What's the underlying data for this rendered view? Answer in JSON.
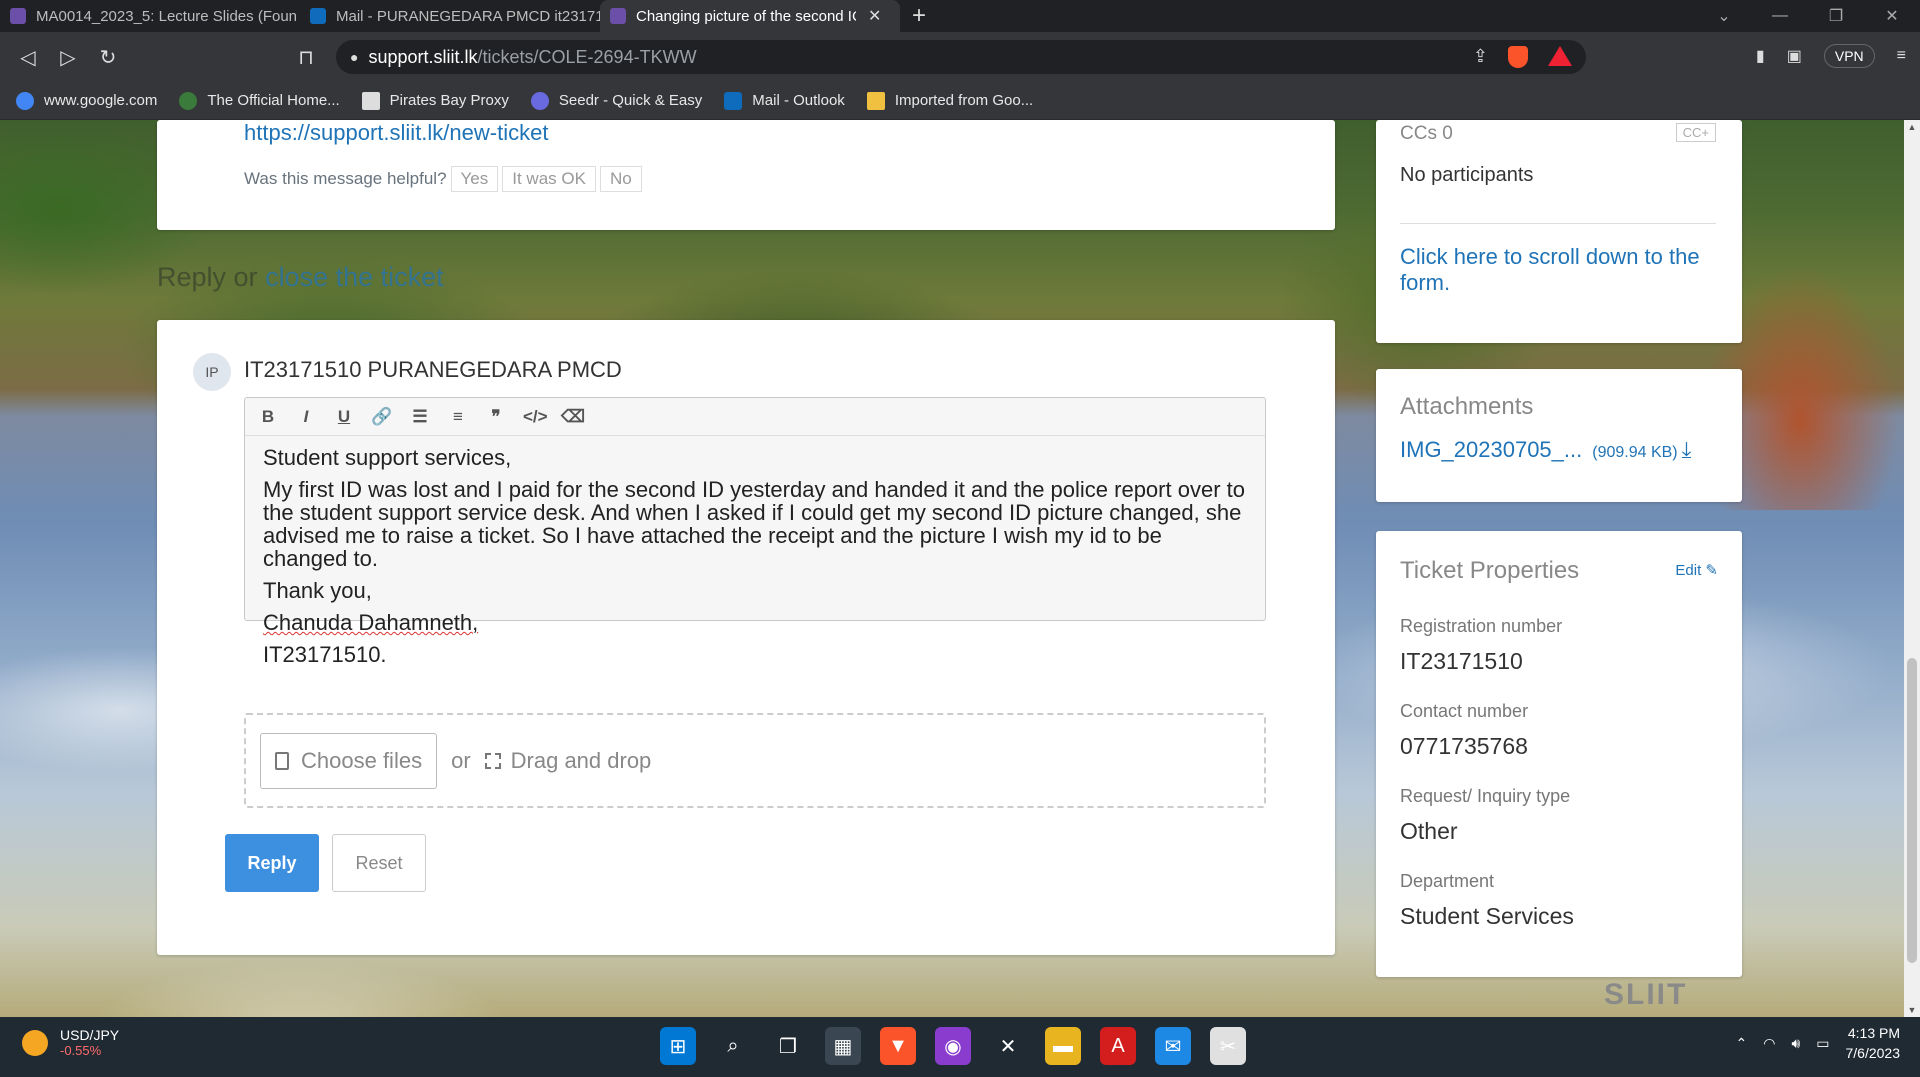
{
  "browser": {
    "tabs": [
      {
        "title": "MA0014_2023_5: Lecture Slides (Foun",
        "active": false,
        "favicon_color": "#6b4fa8"
      },
      {
        "title": "Mail - PURANEGEDARA PMCD it23171",
        "active": false,
        "favicon_color": "#0f6cbd"
      },
      {
        "title": "Changing picture of the second IC",
        "active": true,
        "favicon_color": "#6b4fa8"
      }
    ],
    "new_tab_label": "+",
    "url_host": "support.sliit.lk",
    "url_path": "/tickets/COLE-2694-TKWW",
    "vpn_label": "VPN",
    "bookmarks": [
      {
        "label": "www.google.com",
        "icon": "google-icon",
        "color": "#4285f4"
      },
      {
        "label": "The Official Home...",
        "icon": "leaf-icon",
        "color": "#3a7a3a"
      },
      {
        "label": "Pirates Bay Proxy",
        "icon": "monitor-icon",
        "color": "#dddddd"
      },
      {
        "label": "Seedr - Quick & Easy",
        "icon": "seed-icon",
        "color": "#6a6ae0"
      },
      {
        "label": "Mail - Outlook",
        "icon": "outlook-icon",
        "color": "#0f6cbd"
      },
      {
        "label": "Imported from Goo...",
        "icon": "folder-icon",
        "color": "#f0c040"
      }
    ]
  },
  "ticket": {
    "new_ticket_link": "https://support.sliit.lk/new-ticket",
    "helpful_prompt": "Was this message helpful?",
    "helpful_options": [
      "Yes",
      "It was OK",
      "No"
    ],
    "reply_prefix": "Reply or",
    "close_link": "close the ticket",
    "author_initials": "IP",
    "author_name": "IT23171510 PURANEGEDARA PMCD",
    "toolbar": [
      "B",
      "I",
      "U",
      "🔗",
      "☰",
      "≡",
      "❞",
      "</>",
      "⌫"
    ],
    "message": {
      "greeting": "Student support services,",
      "body": "My first ID was lost and I paid for the second ID yesterday and handed it and the police report over to the student support service desk. And when I asked if I could get my second ID picture changed, she advised me to raise a ticket. So I have attached the receipt and the picture I wish my id to be changed to.",
      "closing": "Thank you,",
      "signature_name": "Chanuda Dahamneth,",
      "signature_id": "IT23171510."
    },
    "choose_files": "Choose files",
    "or_word": "or",
    "drag_drop": "Drag and drop",
    "reply_button": "Reply",
    "reset_button": "Reset"
  },
  "sidebar": {
    "ccs_title": "CCs 0",
    "cc_add": "CC+",
    "no_participants": "No participants",
    "scroll_link": "Click here to scroll down to the form.",
    "attachments_title": "Attachments",
    "attachment_name": "IMG_20230705_...",
    "attachment_size": "(909.94 KB)",
    "properties_title": "Ticket Properties",
    "edit_label": "Edit",
    "properties": [
      {
        "label": "Registration number",
        "value": "IT23171510"
      },
      {
        "label": "Contact number",
        "value": "0771735768"
      },
      {
        "label": "Request/ Inquiry type",
        "value": "Other"
      },
      {
        "label": "Department",
        "value": "Student Services"
      }
    ],
    "background_sign": "SLIIT"
  },
  "taskbar": {
    "ticker_symbol": "USD/JPY",
    "ticker_change": "-0.55%",
    "time": "4:13 PM",
    "date": "7/6/2023"
  }
}
